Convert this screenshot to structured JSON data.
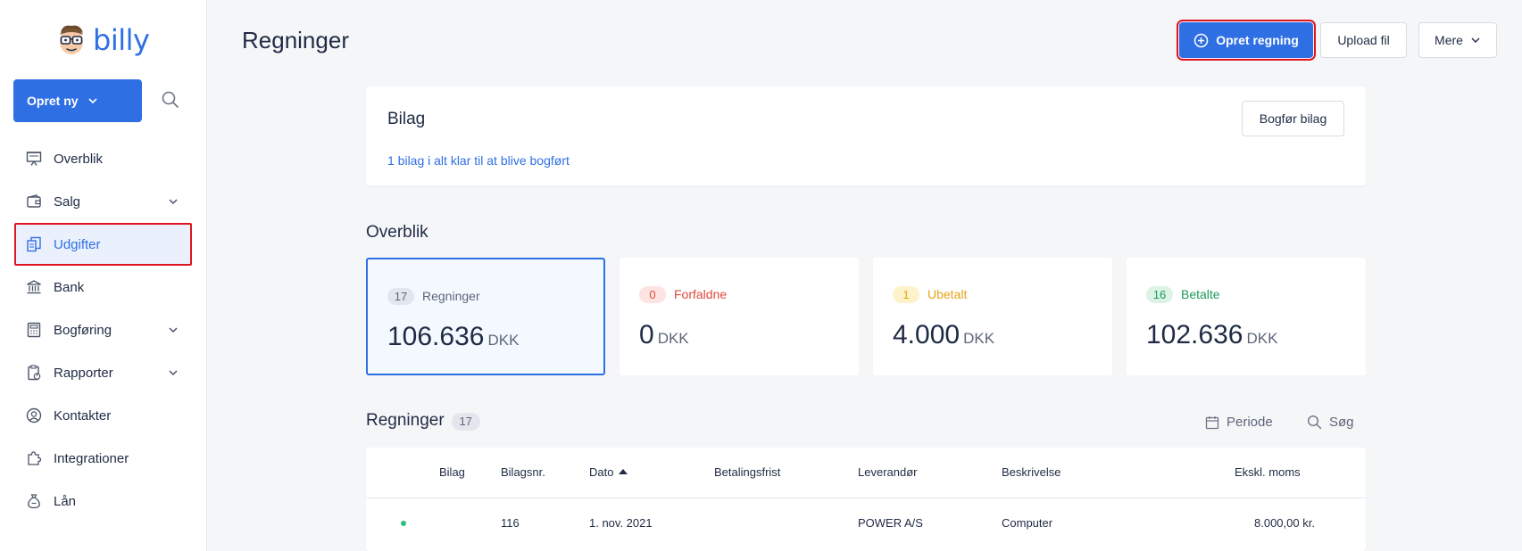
{
  "brand": {
    "name": "billy",
    "accent": "#2f6fe4",
    "highlight": "#e0141e"
  },
  "sidebar": {
    "create_label": "Opret ny",
    "items": [
      {
        "label": "Overblik",
        "icon": "presentation-icon",
        "chevron": false
      },
      {
        "label": "Salg",
        "icon": "wallet-icon",
        "chevron": true
      },
      {
        "label": "Udgifter",
        "icon": "documents-icon",
        "chevron": false,
        "active": true
      },
      {
        "label": "Bank",
        "icon": "bank-icon",
        "chevron": false
      },
      {
        "label": "Bogføring",
        "icon": "calculator-icon",
        "chevron": true
      },
      {
        "label": "Rapporter",
        "icon": "report-icon",
        "chevron": true
      },
      {
        "label": "Kontakter",
        "icon": "contact-icon",
        "chevron": false
      },
      {
        "label": "Integrationer",
        "icon": "puzzle-icon",
        "chevron": false
      },
      {
        "label": "Lån",
        "icon": "moneybag-icon",
        "chevron": false
      }
    ]
  },
  "header": {
    "title": "Regninger",
    "primary_button": "Opret regning",
    "upload_button": "Upload fil",
    "more_button": "Mere"
  },
  "bilag": {
    "title": "Bilag",
    "link": "1 bilag i alt klar til at blive bogført",
    "button": "Bogfør bilag"
  },
  "overview": {
    "title": "Overblik",
    "cards": [
      {
        "count": "17",
        "label": "Regninger",
        "amount": "106.636",
        "unit": "DKK",
        "color": "#5d6679",
        "badge_bg": "#e3e6ec"
      },
      {
        "count": "0",
        "label": "Forfaldne",
        "amount": "0",
        "unit": "DKK",
        "color": "#e0483c",
        "badge_bg": "#fde3e1"
      },
      {
        "count": "1",
        "label": "Ubetalt",
        "amount": "4.000",
        "unit": "DKK",
        "color": "#e6a417",
        "badge_bg": "#fdf2c9"
      },
      {
        "count": "16",
        "label": "Betalte",
        "amount": "102.636",
        "unit": "DKK",
        "color": "#1e9a5c",
        "badge_bg": "#dcf3e6"
      }
    ]
  },
  "table": {
    "title": "Regninger",
    "count": "17",
    "period_label": "Periode",
    "search_label": "Søg",
    "columns": [
      "Bilag",
      "Bilagsnr.",
      "Dato",
      "Betalingsfrist",
      "Leverandør",
      "Beskrivelse",
      "Ekskl. moms"
    ],
    "rows": [
      {
        "bilag": "",
        "bilagsnr": "116",
        "dato": "1. nov. 2021",
        "betalingsfrist": "",
        "leverandor": "POWER A/S",
        "beskrivelse": "Computer",
        "ekskl_moms": "8.000,00 kr."
      }
    ]
  }
}
